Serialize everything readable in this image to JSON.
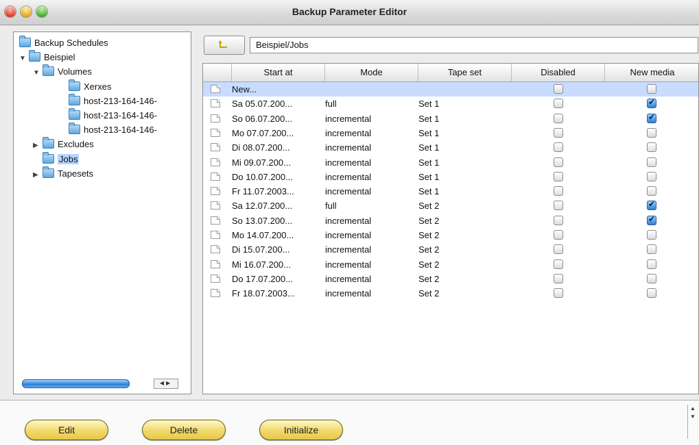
{
  "window": {
    "title": "Backup Parameter Editor"
  },
  "tree": {
    "items": [
      {
        "label": "Backup Schedules",
        "level": 0,
        "twisty": "",
        "selected": false
      },
      {
        "label": "Beispiel",
        "level": 0,
        "twisty": "▼",
        "selected": false
      },
      {
        "label": "Volumes",
        "level": 1,
        "twisty": "▼",
        "selected": false
      },
      {
        "label": "Xerxes",
        "level": 2,
        "twisty": "",
        "selected": false
      },
      {
        "label": "host-213-164-146-",
        "level": 2,
        "twisty": "",
        "selected": false
      },
      {
        "label": "host-213-164-146-",
        "level": 2,
        "twisty": "",
        "selected": false
      },
      {
        "label": "host-213-164-146-",
        "level": 2,
        "twisty": "",
        "selected": false
      },
      {
        "label": "Excludes",
        "level": 1,
        "twisty": "▶",
        "selected": false
      },
      {
        "label": "Jobs",
        "level": 1,
        "twisty": "",
        "selected": true
      },
      {
        "label": "Tapesets",
        "level": 1,
        "twisty": "▶",
        "selected": false
      }
    ]
  },
  "path": {
    "value": "Beispiel/Jobs"
  },
  "table": {
    "columns": [
      "Start at",
      "Mode",
      "Tape set",
      "Disabled",
      "New media"
    ],
    "rows": [
      {
        "start": "New...",
        "mode": "",
        "tapeset": "",
        "disabled": false,
        "newmedia": false,
        "selected": true
      },
      {
        "start": "Sa 05.07.200...",
        "mode": "full",
        "tapeset": "Set 1",
        "disabled": false,
        "newmedia": true
      },
      {
        "start": "So 06.07.200...",
        "mode": "incremental",
        "tapeset": "Set 1",
        "disabled": false,
        "newmedia": true
      },
      {
        "start": "Mo 07.07.200...",
        "mode": "incremental",
        "tapeset": "Set 1",
        "disabled": false,
        "newmedia": false
      },
      {
        "start": "Di 08.07.200...",
        "mode": "incremental",
        "tapeset": "Set 1",
        "disabled": false,
        "newmedia": false
      },
      {
        "start": "Mi 09.07.200...",
        "mode": "incremental",
        "tapeset": "Set 1",
        "disabled": false,
        "newmedia": false
      },
      {
        "start": "Do 10.07.200...",
        "mode": "incremental",
        "tapeset": "Set 1",
        "disabled": false,
        "newmedia": false
      },
      {
        "start": "Fr 11.07.2003...",
        "mode": "incremental",
        "tapeset": "Set 1",
        "disabled": false,
        "newmedia": false
      },
      {
        "start": "Sa 12.07.200...",
        "mode": "full",
        "tapeset": "Set 2",
        "disabled": false,
        "newmedia": true
      },
      {
        "start": "So 13.07.200...",
        "mode": "incremental",
        "tapeset": "Set 2",
        "disabled": false,
        "newmedia": true
      },
      {
        "start": "Mo 14.07.200...",
        "mode": "incremental",
        "tapeset": "Set 2",
        "disabled": false,
        "newmedia": false
      },
      {
        "start": "Di 15.07.200...",
        "mode": "incremental",
        "tapeset": "Set 2",
        "disabled": false,
        "newmedia": false
      },
      {
        "start": "Mi 16.07.200...",
        "mode": "incremental",
        "tapeset": "Set 2",
        "disabled": false,
        "newmedia": false
      },
      {
        "start": "Do 17.07.200...",
        "mode": "incremental",
        "tapeset": "Set 2",
        "disabled": false,
        "newmedia": false
      },
      {
        "start": "Fr 18.07.2003...",
        "mode": "incremental",
        "tapeset": "Set 2",
        "disabled": false,
        "newmedia": false
      }
    ]
  },
  "buttons": {
    "edit": "Edit",
    "delete": "Delete",
    "initialize": "Initialize"
  },
  "icons": {
    "window_close": "close-light",
    "window_minimize": "minimize-light",
    "window_zoom": "zoom-light",
    "tree_node": "folder-icon",
    "table_row": "document-icon",
    "path_button": "up-folder-icon"
  }
}
